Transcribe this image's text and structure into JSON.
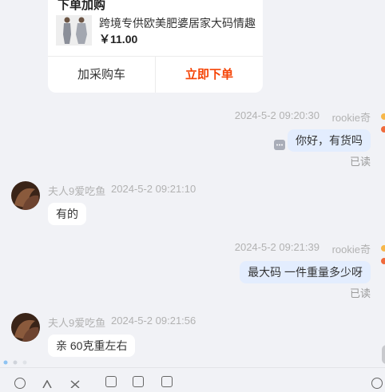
{
  "product_card": {
    "title": "下单加购",
    "name": "跨境专供欧美肥婆居家大码情趣",
    "price": "￥11.00",
    "add_cart_label": "加采购车",
    "order_now_label": "立即下单"
  },
  "messages": [
    {
      "side": "right",
      "time": "2024-5-2 09:20:30",
      "user": "rookie奇",
      "text": "你好，有货吗",
      "status": "已读"
    },
    {
      "side": "left",
      "user": "夫人9爱吃鱼",
      "time": "2024-5-2 09:21:10",
      "text": "有的"
    },
    {
      "side": "right",
      "time": "2024-5-2 09:21:39",
      "user": "rookie奇",
      "text": "最大码 一件重量多少呀",
      "status": "已读"
    },
    {
      "side": "left",
      "user": "夫人9爱吃鱼",
      "time": "2024-5-2 09:21:56",
      "text": "亲 60克重左右"
    }
  ],
  "colors": {
    "background": "#f1f2f6",
    "accent_orange": "#f54406",
    "right_bubble": "#e3edfe",
    "left_bubble": "#ffffff"
  },
  "icons": [
    "more-icon",
    "emoji-icon",
    "scissors-icon",
    "image-icon",
    "folder-icon",
    "chat-icon"
  ]
}
